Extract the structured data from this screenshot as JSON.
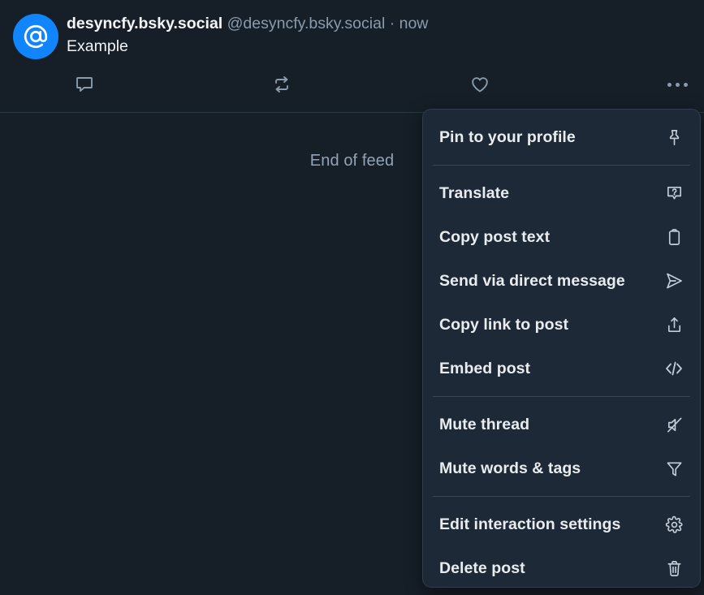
{
  "post": {
    "avatar_icon": "at-sign-avatar-icon",
    "avatar_color": "#1185fe",
    "display_name": "desyncfy.bsky.social",
    "handle_and_time": "@desyncfy.bsky.social · now",
    "text": "Example",
    "actions": [
      {
        "name": "reply-button",
        "icon": "reply-bubble-icon"
      },
      {
        "name": "repost-button",
        "icon": "repost-arrows-icon"
      },
      {
        "name": "like-button",
        "icon": "heart-icon"
      },
      {
        "name": "more-options-button",
        "icon": "ellipsis-icon"
      }
    ]
  },
  "feed": {
    "end_of_feed_label": "End of feed"
  },
  "menu": {
    "groups": [
      {
        "items": [
          {
            "label": "Pin to your profile",
            "icon": "pin-icon",
            "name": "menu-item-pin-to-your-profile"
          }
        ]
      },
      {
        "items": [
          {
            "label": "Translate",
            "icon": "translate-icon",
            "name": "menu-item-translate"
          },
          {
            "label": "Copy post text",
            "icon": "clipboard-icon",
            "name": "menu-item-copy-post-text"
          },
          {
            "label": "Send via direct message",
            "icon": "send-paper-plane-icon",
            "name": "menu-item-send-via-direct-message"
          },
          {
            "label": "Copy link to post",
            "icon": "share-export-icon",
            "name": "menu-item-copy-link-to-post"
          },
          {
            "label": "Embed post",
            "icon": "code-brackets-icon",
            "name": "menu-item-embed-post"
          }
        ]
      },
      {
        "items": [
          {
            "label": "Mute thread",
            "icon": "speaker-muted-icon",
            "name": "menu-item-mute-thread"
          },
          {
            "label": "Mute words & tags",
            "icon": "filter-funnel-icon",
            "name": "menu-item-mute-words-and-tags"
          }
        ]
      },
      {
        "items": [
          {
            "label": "Edit interaction settings",
            "icon": "gear-icon",
            "name": "menu-item-edit-interaction-settings"
          },
          {
            "label": "Delete post",
            "icon": "trash-icon",
            "name": "menu-item-delete-post"
          }
        ]
      }
    ]
  },
  "colors": {
    "background": "#161e27",
    "menu_background": "#1d2936",
    "accent": "#1185fe",
    "muted_text": "#8a9bae",
    "divider": "#2b3947"
  }
}
